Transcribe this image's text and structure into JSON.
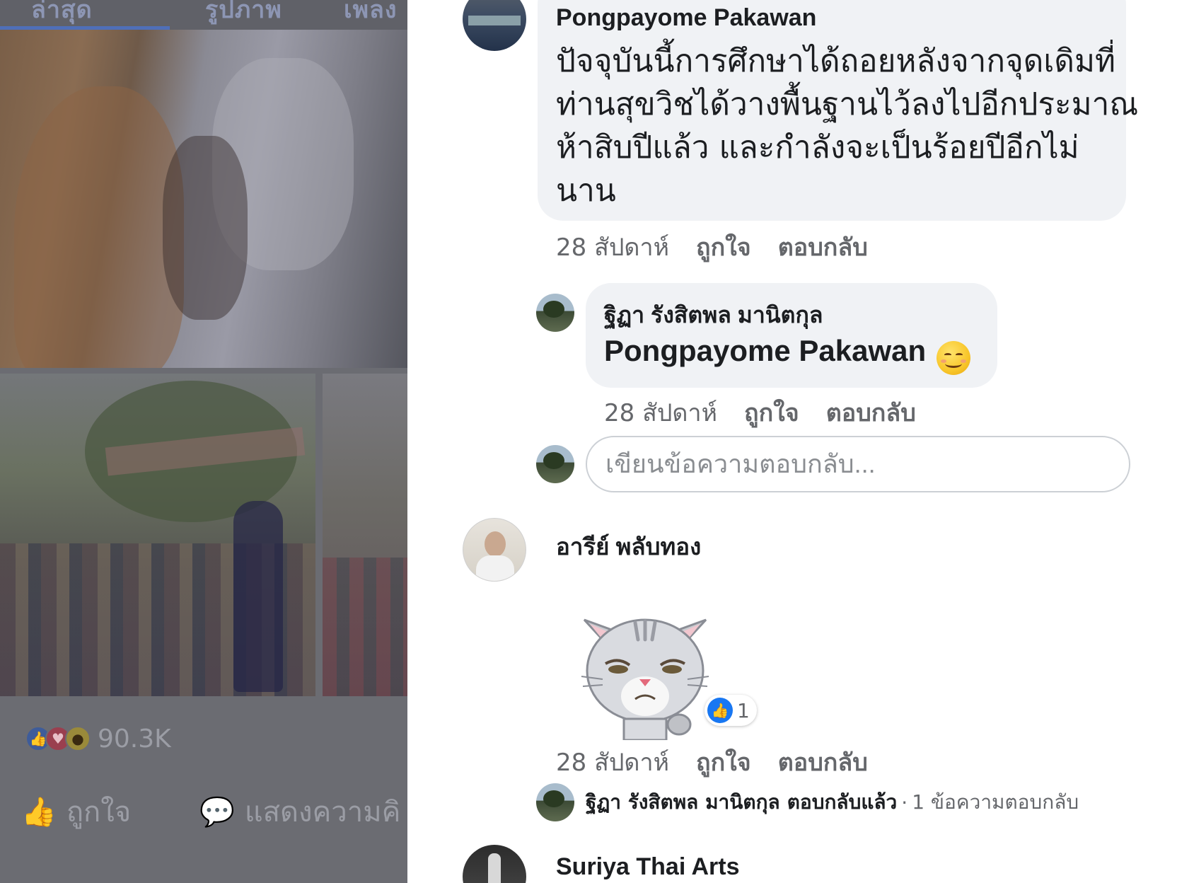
{
  "left_panel": {
    "tabs": [
      "ล่าสุด",
      "รูปภาพ",
      "เพลง"
    ],
    "reactions": {
      "icons": [
        "like-icon",
        "love-icon",
        "wow-icon"
      ],
      "count": "90.3K"
    },
    "actions": {
      "like_label": "ถูกใจ",
      "comment_label": "แสดงความคิ"
    }
  },
  "comments": [
    {
      "author": "Pongpayome Pakawan",
      "lines": [
        "ปัจจุบันนี้การศึกษาได้ถอยหลังจากจุดเดิมที่",
        "ท่านสุขวิชได้วางพื้นฐานไว้ลงไปอีกประมาณ",
        "ห้าสิบปีแล้ว และกำลังจะเป็นร้อยปีอีกไม่",
        "นาน"
      ],
      "time": "28 สัปดาห์",
      "like": "ถูกใจ",
      "reply": "ตอบกลับ",
      "replies": [
        {
          "author": "ฐิฏา รังสิตพล มานิตกุล",
          "mention": "Pongpayome Pakawan",
          "emoji": "smiling-face-icon",
          "time": "28 สัปดาห์",
          "like": "ถูกใจ",
          "reply": "ตอบกลับ"
        }
      ],
      "reply_input_placeholder": "เขียนข้อความตอบกลับ..."
    },
    {
      "author": "อารีย์ พลับทอง",
      "sticker": "grumpy-cat-sticker",
      "like_reactions": "1",
      "time": "28 สัปดาห์",
      "like": "ถูกใจ",
      "reply": "ตอบกลับ",
      "replies_summary": {
        "name": "ฐิฏา รังสิตพล มานิตกุล",
        "verb": "ตอบกลับแล้ว",
        "separator": "·",
        "count_text": "1 ข้อความตอบกลับ"
      }
    },
    {
      "author": "Suriya Thai Arts"
    }
  ]
}
